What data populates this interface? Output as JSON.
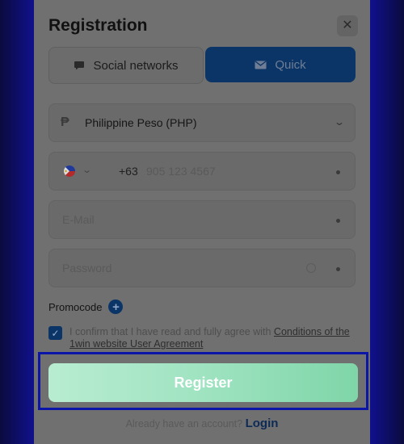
{
  "modal": {
    "title": "Registration",
    "close_icon": "close-icon"
  },
  "tabs": [
    {
      "label": "Social networks",
      "icon": "chat-bubble-icon",
      "active": false
    },
    {
      "label": "Quick",
      "icon": "envelope-icon",
      "active": true
    }
  ],
  "form": {
    "currency": {
      "value": "Philippine Peso (PHP)",
      "icon": "peso-icon"
    },
    "phone": {
      "country": "Philippines",
      "code": "+63",
      "placeholder": "905 123 4567"
    },
    "email": {
      "placeholder": "E-Mail"
    },
    "password": {
      "placeholder": "Password"
    },
    "promocode_label": "Promocode",
    "agreement": {
      "checked": true,
      "text": "I confirm that I have read and fully agree with ",
      "link": "Conditions of the 1win website User Agreement"
    },
    "register_label": "Register"
  },
  "footer": {
    "prompt": "Already have an account?",
    "login_label": "Login"
  },
  "colors": {
    "modal_bg": "#707070",
    "quick_tab": "#0b3567",
    "register_green": "#9fe3c1",
    "highlight_border": "#0b16a8"
  }
}
